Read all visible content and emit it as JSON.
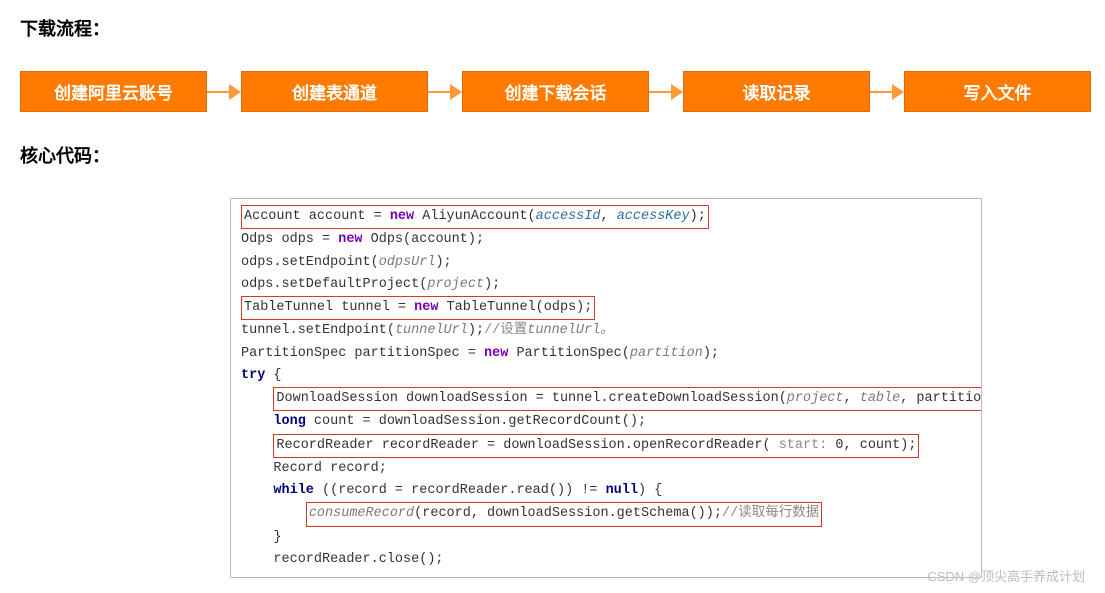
{
  "title1": "下载流程：",
  "steps": [
    "创建阿里云账号",
    "创建表通道",
    "创建下载会话",
    "读取记录",
    "写入文件"
  ],
  "title2": "核心代码：",
  "code": {
    "l1_a": "Account account = ",
    "l1_new": "new",
    "l1_b": " AliyunAccount(",
    "l1_p1": "accessId",
    "l1_c": ", ",
    "l1_p2": "accessKey",
    "l1_d": ");",
    "l2_a": "Odps odps = ",
    "l2_new": "new",
    "l2_b": " Odps(account);",
    "l3_a": "odps.setEndpoint(",
    "l3_p": "odpsUrl",
    "l3_b": ");",
    "l4_a": "odps.setDefaultProject(",
    "l4_p": "project",
    "l4_b": ");",
    "l5_a": "TableTunnel tunnel = ",
    "l5_new": "new",
    "l5_b": " TableTunnel(odps);",
    "l6_a": "tunnel.setEndpoint(",
    "l6_p": "tunnelUrl",
    "l6_b": ");",
    "l6_c": "//设置",
    "l6_c2": "tunnelUrl。",
    "l7_a": "PartitionSpec partitionSpec = ",
    "l7_new": "new",
    "l7_b": " PartitionSpec(",
    "l7_p": "partition",
    "l7_c": ");",
    "l8": "try",
    "l8b": " {",
    "l9_a": "DownloadSession downloadSession = tunnel.createDownloadSession(",
    "l9_p1": "project",
    "l9_c1": ", ",
    "l9_p2": "table",
    "l9_c2": ", partitionSpec);",
    "l10_kw": "long",
    "l10_a": " count = downloadSession.getRecordCount();",
    "l11_a": "RecordReader recordReader = downloadSession.openRecordReader(",
    "l11_h": " start: ",
    "l11_v": "0",
    "l11_b": ", count);",
    "l12": "Record record;",
    "l13_kw": "while",
    "l13_a": " ((record = recordReader.read()) != ",
    "l13_n": "null",
    "l13_b": ") {",
    "l14_a": "consumeRecord",
    "l14_b": "(record, downloadSession.getSchema());",
    "l14_c": "//读取每行数据",
    "l15": "}",
    "l16": "recordReader.close();"
  },
  "watermark": "CSDN @顶尖高手养成计划"
}
